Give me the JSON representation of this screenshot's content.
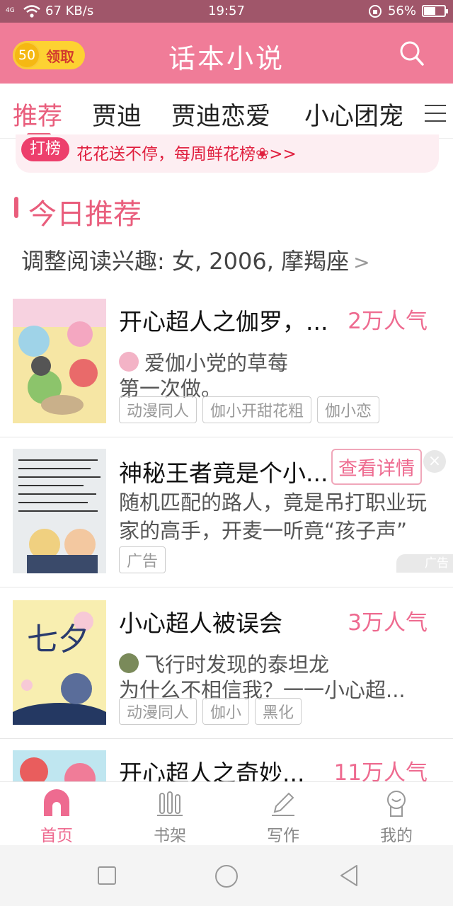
{
  "status_bar": {
    "network": "4G",
    "speed": "67 KB/s",
    "time": "19:57",
    "battery": "56%",
    "battery_level": 0.56
  },
  "header": {
    "title": "话本小说",
    "coin_value": "50",
    "coin_label": "领取"
  },
  "tabs": [
    {
      "label": "推荐",
      "active": true
    },
    {
      "label": "贾迪"
    },
    {
      "label": "贾迪恋爱"
    },
    {
      "label": "小心团宠"
    }
  ],
  "banner": {
    "chip": "打榜",
    "text": "花花送不停，每周鲜花榜❀>>"
  },
  "section": {
    "title": "今日推荐",
    "interest": "调整阅读兴趣: 女, 2006, 摩羯座"
  },
  "items": [
    {
      "title": "开心超人之伽罗，...",
      "popularity": "2万人气",
      "author": "爱伽小党的草莓",
      "desc": "第一次做。",
      "tags": [
        "动漫同人",
        "伽小开甜花粗",
        "伽小恋"
      ]
    },
    {
      "title": "神秘王者竟是个小...",
      "detail_button": "查看详情",
      "close": "×",
      "desc": "随机匹配的路人，竟是吊打职业玩家的高手，开麦一听竟“孩子声”",
      "tag": "广告",
      "ad_mark": "广告"
    },
    {
      "title": "小心超人被误会",
      "popularity": "3万人气",
      "author": "飞行时发现的泰坦龙",
      "desc": "为什么不相信我？一一小心超...",
      "tags": [
        "动漫同人",
        "伽小",
        "黑化"
      ],
      "cover_text": "七夕"
    },
    {
      "title": "开心超人之奇妙...",
      "popularity": "11万人气"
    }
  ],
  "bottom_nav": [
    {
      "label": "首页",
      "icon": "home-icon",
      "active": true
    },
    {
      "label": "书架",
      "icon": "bookshelf-icon"
    },
    {
      "label": "写作",
      "icon": "pen-icon"
    },
    {
      "label": "我的",
      "icon": "profile-icon"
    }
  ],
  "colors": {
    "brand": "#f07c98",
    "accent": "#e95d7c",
    "status_bar": "#a0566a"
  }
}
